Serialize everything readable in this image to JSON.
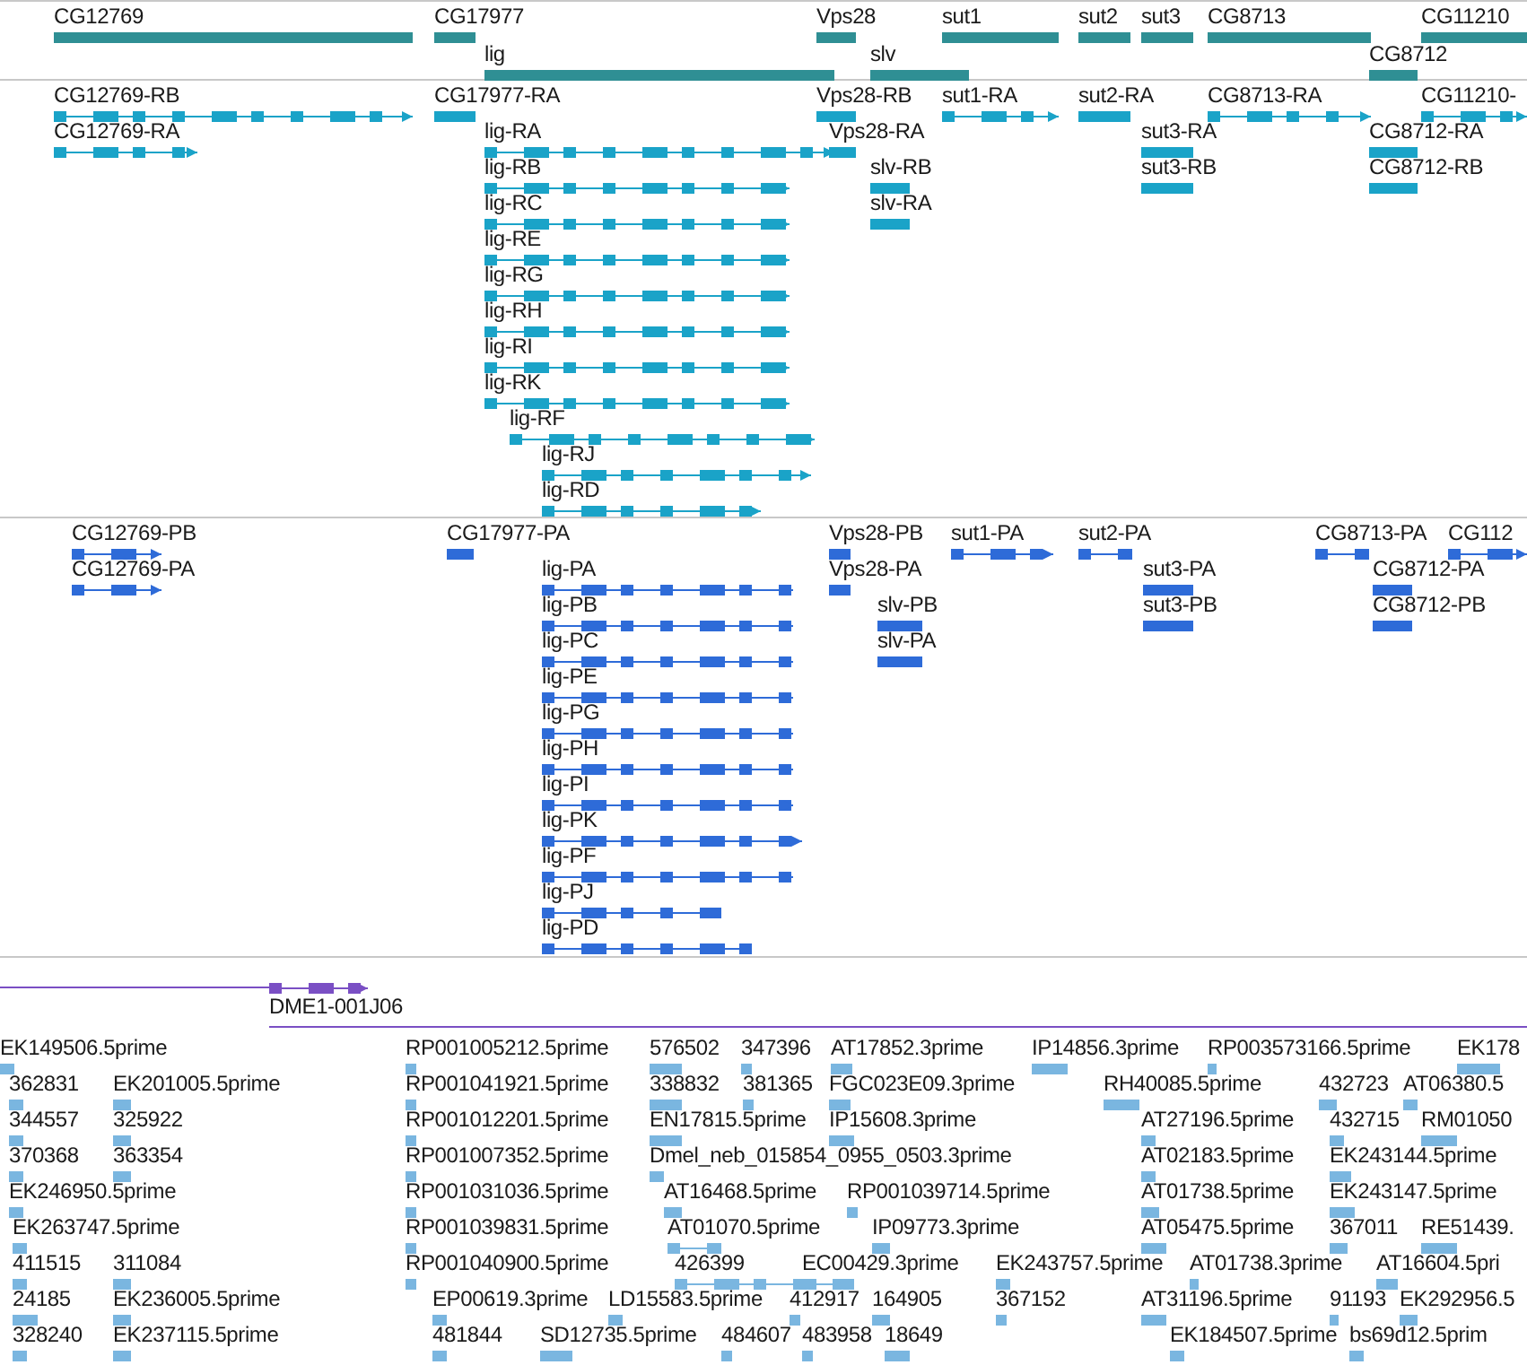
{
  "tracks": [
    {
      "kind": "gene",
      "features": [
        {
          "label": "CG12769"
        },
        {
          "label": "CG17977"
        },
        {
          "label": "Vps28"
        },
        {
          "label": "sut1"
        },
        {
          "label": "sut2"
        },
        {
          "label": "sut3"
        },
        {
          "label": "CG8713"
        },
        {
          "label": "CG11210"
        },
        {
          "label": "lig"
        },
        {
          "label": "slv"
        },
        {
          "label": "CG8712"
        }
      ]
    },
    {
      "kind": "transcript",
      "features": [
        {
          "label": "CG12769-RB"
        },
        {
          "label": "CG12769-RA"
        },
        {
          "label": "CG17977-RA"
        },
        {
          "label": "lig-RA"
        },
        {
          "label": "lig-RB"
        },
        {
          "label": "lig-RC"
        },
        {
          "label": "lig-RE"
        },
        {
          "label": "lig-RG"
        },
        {
          "label": "lig-RH"
        },
        {
          "label": "lig-RI"
        },
        {
          "label": "lig-RK"
        },
        {
          "label": "lig-RF"
        },
        {
          "label": "lig-RJ"
        },
        {
          "label": "lig-RD"
        },
        {
          "label": "Vps28-RB"
        },
        {
          "label": "Vps28-RA"
        },
        {
          "label": "slv-RB"
        },
        {
          "label": "slv-RA"
        },
        {
          "label": "sut1-RA"
        },
        {
          "label": "sut2-RA"
        },
        {
          "label": "sut3-RA"
        },
        {
          "label": "sut3-RB"
        },
        {
          "label": "CG8713-RA"
        },
        {
          "label": "CG11210-"
        },
        {
          "label": "CG8712-RA"
        },
        {
          "label": "CG8712-RB"
        }
      ]
    },
    {
      "kind": "protein",
      "features": [
        {
          "label": "CG12769-PB"
        },
        {
          "label": "CG12769-PA"
        },
        {
          "label": "CG17977-PA"
        },
        {
          "label": "lig-PA"
        },
        {
          "label": "lig-PB"
        },
        {
          "label": "lig-PC"
        },
        {
          "label": "lig-PE"
        },
        {
          "label": "lig-PG"
        },
        {
          "label": "lig-PH"
        },
        {
          "label": "lig-PI"
        },
        {
          "label": "lig-PK"
        },
        {
          "label": "lig-PF"
        },
        {
          "label": "lig-PJ"
        },
        {
          "label": "lig-PD"
        },
        {
          "label": "Vps28-PB"
        },
        {
          "label": "Vps28-PA"
        },
        {
          "label": "slv-PB"
        },
        {
          "label": "slv-PA"
        },
        {
          "label": "sut1-PA"
        },
        {
          "label": "sut2-PA"
        },
        {
          "label": "sut3-PA"
        },
        {
          "label": "sut3-PB"
        },
        {
          "label": "CG8713-PA"
        },
        {
          "label": "CG112"
        },
        {
          "label": "CG8712-PA"
        },
        {
          "label": "CG8712-PB"
        }
      ]
    },
    {
      "kind": "clone",
      "features": [
        {
          "label": "DME1-001J06"
        }
      ]
    },
    {
      "kind": "est",
      "features": [
        {
          "label": "EK149506.5prime"
        },
        {
          "label": "RP001005212.5prime"
        },
        {
          "label": "576502"
        },
        {
          "label": "347396"
        },
        {
          "label": "AT17852.3prime"
        },
        {
          "label": "IP14856.3prime"
        },
        {
          "label": "RP003573166.5prime"
        },
        {
          "label": "EK178"
        },
        {
          "label": "362831"
        },
        {
          "label": "EK201005.5prime"
        },
        {
          "label": "RP001041921.5prime"
        },
        {
          "label": "338832"
        },
        {
          "label": "381365"
        },
        {
          "label": "FGC023E09.3prime"
        },
        {
          "label": "RH40085.5prime"
        },
        {
          "label": "432723"
        },
        {
          "label": "AT06380.5"
        },
        {
          "label": "344557"
        },
        {
          "label": "325922"
        },
        {
          "label": "RP001012201.5prime"
        },
        {
          "label": "EN17815.5prime"
        },
        {
          "label": "IP15608.3prime"
        },
        {
          "label": "AT27196.5prime"
        },
        {
          "label": "432715"
        },
        {
          "label": "RM01050"
        },
        {
          "label": "370368"
        },
        {
          "label": "363354"
        },
        {
          "label": "RP001007352.5prime"
        },
        {
          "label": "Dmel_neb_015854_0955_0503.3prime"
        },
        {
          "label": "AT02183.5prime"
        },
        {
          "label": "EK243144.5prime"
        },
        {
          "label": "EK246950.5prime"
        },
        {
          "label": "RP001031036.5prime"
        },
        {
          "label": "AT16468.5prime"
        },
        {
          "label": "RP001039714.5prime"
        },
        {
          "label": "AT01738.5prime"
        },
        {
          "label": "EK243147.5prime"
        },
        {
          "label": "EK263747.5prime"
        },
        {
          "label": "RP001039831.5prime"
        },
        {
          "label": "AT01070.5prime"
        },
        {
          "label": "IP09773.3prime"
        },
        {
          "label": "AT05475.5prime"
        },
        {
          "label": "367011"
        },
        {
          "label": "RE51439."
        },
        {
          "label": "411515"
        },
        {
          "label": "311084"
        },
        {
          "label": "RP001040900.5prime"
        },
        {
          "label": "426399"
        },
        {
          "label": "EC00429.3prime"
        },
        {
          "label": "EK243757.5prime"
        },
        {
          "label": "AT01738.3prime"
        },
        {
          "label": "AT16604.5pri"
        },
        {
          "label": "24185"
        },
        {
          "label": "EK236005.5prime"
        },
        {
          "label": "EP00619.3prime"
        },
        {
          "label": "LD15583.5prime"
        },
        {
          "label": "412917"
        },
        {
          "label": "164905"
        },
        {
          "label": "367152"
        },
        {
          "label": "AT31196.5prime"
        },
        {
          "label": "91193"
        },
        {
          "label": "EK292956.5"
        },
        {
          "label": "328240"
        },
        {
          "label": "EK237115.5prime"
        },
        {
          "label": "481844"
        },
        {
          "label": "SD12735.5prime"
        },
        {
          "label": "484607"
        },
        {
          "label": "483958"
        },
        {
          "label": "18649"
        },
        {
          "label": "EK184507.5prime"
        },
        {
          "label": "bs69d12.5prim"
        }
      ]
    }
  ]
}
